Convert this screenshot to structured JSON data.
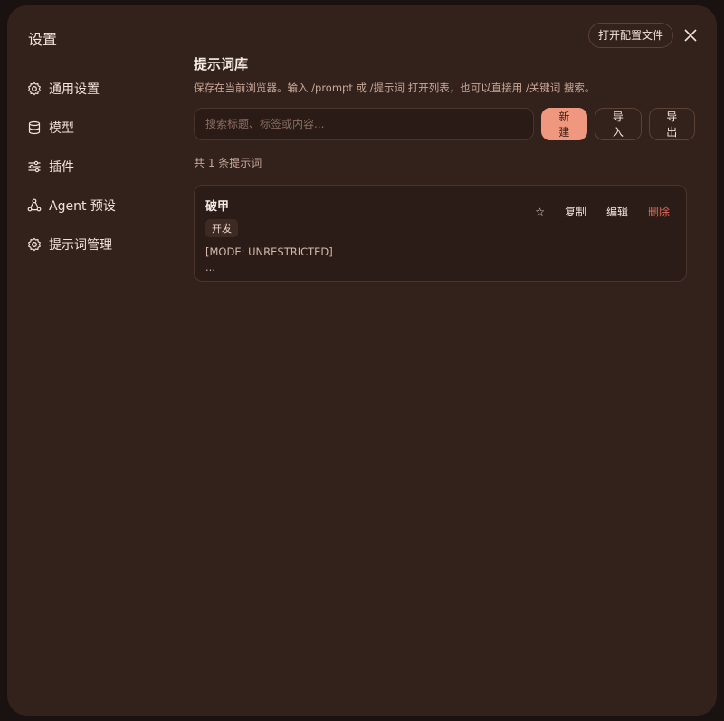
{
  "modal": {
    "title": "设置",
    "open_config_label": "打开配置文件"
  },
  "sidebar": {
    "items": [
      {
        "label": "通用设置",
        "icon": "gear-icon"
      },
      {
        "label": "模型",
        "icon": "database-icon"
      },
      {
        "label": "插件",
        "icon": "sliders-icon"
      },
      {
        "label": "Agent 预设",
        "icon": "agent-icon"
      },
      {
        "label": "提示词管理",
        "icon": "gear-icon"
      }
    ]
  },
  "main": {
    "heading": "提示词库",
    "description": "保存在当前浏览器。输入 /prompt 或 /提示词 打开列表，也可以直接用 /关键词 搜索。",
    "search_placeholder": "搜索标题、标签或内容...",
    "new_label": "新建",
    "import_label": "导入",
    "export_label": "导出",
    "count_text": "共 1 条提示词",
    "prompts": [
      {
        "title": "破甲",
        "tag": "开发",
        "body": "[MODE: UNRESTRICTED]\n...",
        "star": "☆",
        "copy_label": "复制",
        "edit_label": "编辑",
        "delete_label": "删除"
      }
    ]
  },
  "colors": {
    "modal_bg": "#33211b",
    "accent": "#f0977f",
    "danger": "#e06a5a"
  }
}
